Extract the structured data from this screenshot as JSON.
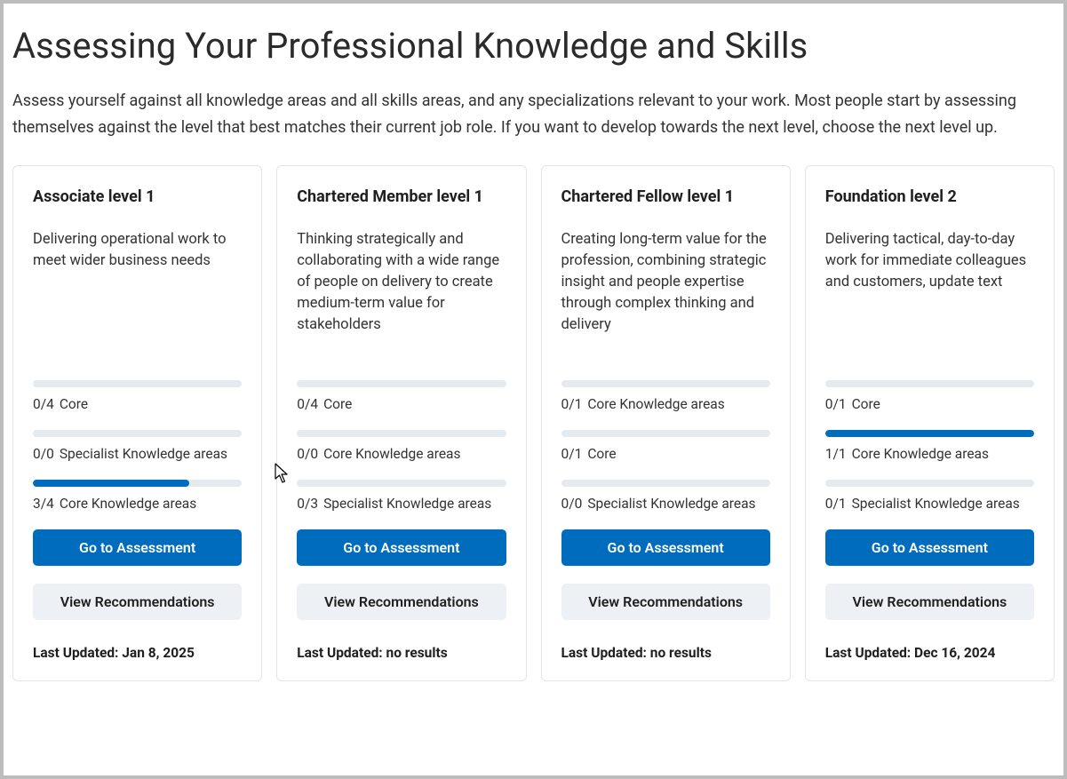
{
  "page": {
    "title": "Assessing Your Professional Knowledge and Skills",
    "intro": "Assess yourself against all knowledge areas and all skills areas, and any specializations relevant to your work. Most people start by assessing themselves against the level that best matches their current job role. If you want to develop towards the next level, choose the next level up."
  },
  "buttons": {
    "assess": "Go to Assessment",
    "recommend": "View Recommendations"
  },
  "lastUpdatedPrefix": "Last Updated: ",
  "cards": [
    {
      "title": "Associate level 1",
      "description": "Delivering operational work to meet wider business needs",
      "progress": [
        {
          "count": "0/4",
          "label": "Core",
          "pct": 0
        },
        {
          "count": "0/0",
          "label": "Specialist Knowledge areas",
          "pct": 0
        },
        {
          "count": "3/4",
          "label": "Core Knowledge areas",
          "pct": 75
        }
      ],
      "lastUpdated": "Jan 8, 2025"
    },
    {
      "title": "Chartered Member level 1",
      "description": "Thinking strategically and collaborating with a wide range of people on delivery to create medium-term value for stakeholders",
      "progress": [
        {
          "count": "0/4",
          "label": "Core",
          "pct": 0
        },
        {
          "count": "0/0",
          "label": "Core Knowledge areas",
          "pct": 0
        },
        {
          "count": "0/3",
          "label": "Specialist Knowledge areas",
          "pct": 0
        }
      ],
      "lastUpdated": "no results"
    },
    {
      "title": "Chartered Fellow level 1",
      "description": "Creating long-term value for the profession, combining strategic insight and people expertise through complex thinking and delivery",
      "progress": [
        {
          "count": "0/1",
          "label": "Core Knowledge areas",
          "pct": 0
        },
        {
          "count": "0/1",
          "label": "Core",
          "pct": 0
        },
        {
          "count": "0/0",
          "label": "Specialist Knowledge areas",
          "pct": 0
        }
      ],
      "lastUpdated": "no results"
    },
    {
      "title": "Foundation level 2",
      "description": "Delivering tactical, day-to-day work for immediate colleagues and customers, update text",
      "progress": [
        {
          "count": "0/1",
          "label": "Core",
          "pct": 0
        },
        {
          "count": "1/1",
          "label": "Core Knowledge areas",
          "pct": 100
        },
        {
          "count": "0/1",
          "label": "Specialist Knowledge areas",
          "pct": 0
        }
      ],
      "lastUpdated": "Dec 16, 2024"
    }
  ]
}
